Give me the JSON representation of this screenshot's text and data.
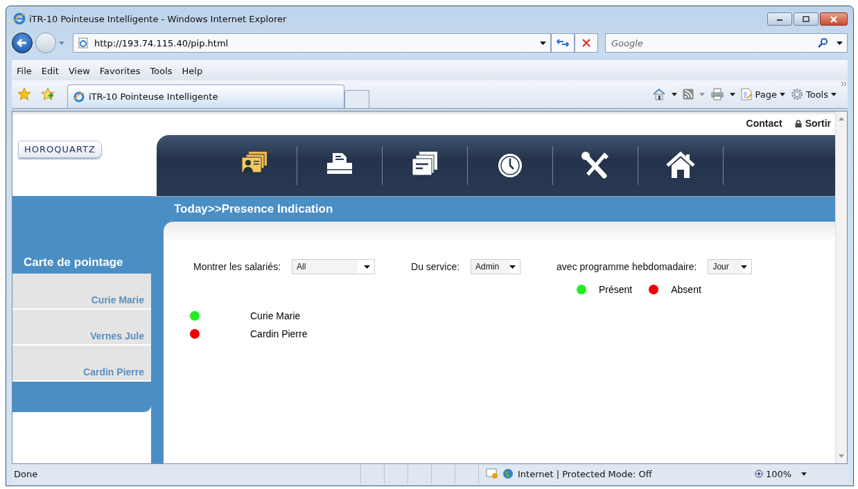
{
  "window": {
    "title": "iTR-10 Pointeuse Intelligente - Windows Internet Explorer"
  },
  "address_bar": {
    "url": "http://193.74.115.40/pip.html",
    "search_placeholder": "Google"
  },
  "menu": [
    "File",
    "Edit",
    "View",
    "Favorites",
    "Tools",
    "Help"
  ],
  "tabs": [
    {
      "label": "iTR-10 Pointeuse Intelligente",
      "selected": true
    }
  ],
  "command_bar": [
    "Page",
    "Tools"
  ],
  "page": {
    "top_links": [
      "Contact",
      "Sortir"
    ],
    "logo": "HOROQUARTZ",
    "breadcrumb": "Today>>Presence Indication",
    "sidebar": {
      "title": "Carte de pointage",
      "items": [
        "Curie Marie",
        "Vernes Jule",
        "Cardin Pierre"
      ]
    },
    "filters": [
      {
        "label": "Montrer les salariés:",
        "value": "All"
      },
      {
        "label": "Du service:",
        "value": "Admin"
      },
      {
        "label": "avec programme hebdomadaire:",
        "value": "Jour"
      }
    ],
    "legend": [
      {
        "label": "Présent",
        "color": "#22ee22"
      },
      {
        "label": "Absent",
        "color": "#ee0000"
      }
    ],
    "employees": [
      {
        "name": "Curie Marie",
        "color": "#22ee22"
      },
      {
        "name": "Cardin Pierre",
        "color": "#ee0000"
      }
    ]
  },
  "status_bar": {
    "text": "Done",
    "zone": "Internet | Protected Mode: Off",
    "zoom": "100%"
  }
}
